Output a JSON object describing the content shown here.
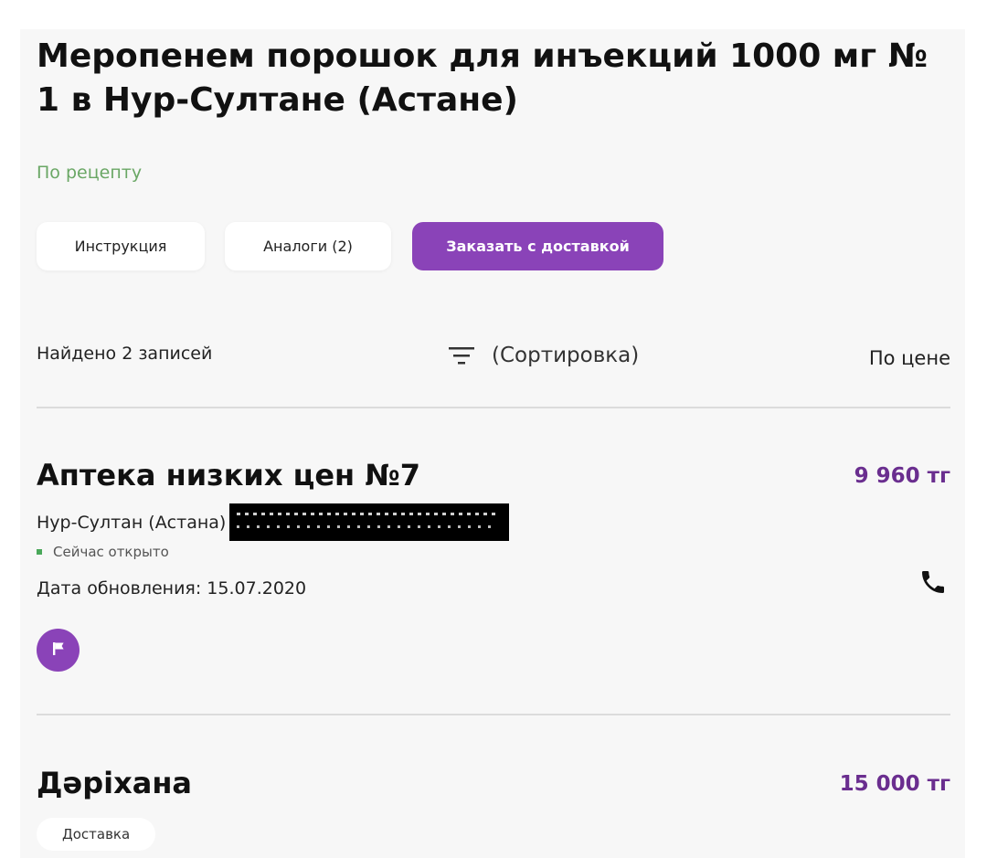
{
  "product": {
    "title": "Меропенем порошок для инъекций 1000 мг № 1 в Нур-Султане (Астане)",
    "prescription_label": "По рецепту"
  },
  "actions": {
    "instruction_label": "Инструкция",
    "analogs_label": "Аналоги (2)",
    "order_label": "Заказать с доставкой"
  },
  "results": {
    "found_text": "Найдено 2 записей",
    "sort_label": "(Сортировка)",
    "sort_value": "По цене"
  },
  "pharmacies": [
    {
      "name": "Аптека низких цен №7",
      "price": "9 960 тг",
      "city": "Нур-Султан (Астана)",
      "status": "Сейчас открыто",
      "updated": "Дата обновления: 15.07.2020"
    },
    {
      "name": "Дәріхана",
      "price": "15 000 тг",
      "badge": "Доставка"
    }
  ],
  "colors": {
    "accent": "#8a43b8",
    "price": "#6a2e8f",
    "prescription": "#6aa765",
    "open_status": "#4aa85a"
  },
  "icons": {
    "sort": "sort-icon",
    "phone": "phone-icon",
    "flag": "flag-icon"
  }
}
